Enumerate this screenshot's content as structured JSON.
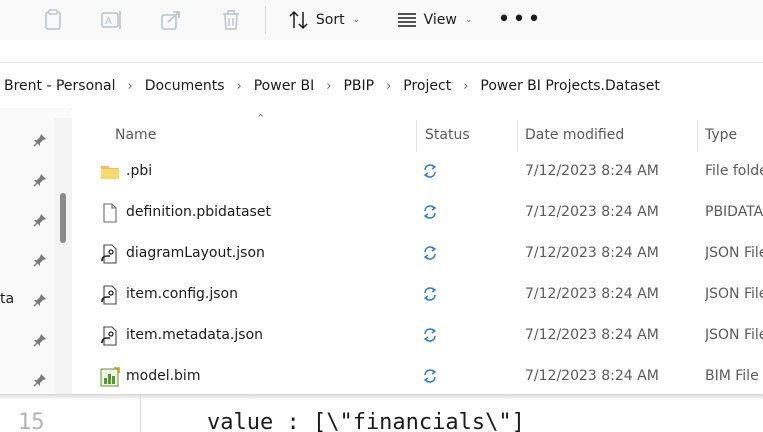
{
  "toolbar": {
    "sort_label": "Sort",
    "view_label": "View",
    "more_label": "•••",
    "icons": [
      "clipboard-icon",
      "rename-icon",
      "share-icon",
      "delete-icon",
      "sort-icon",
      "view-icon",
      "more-icon"
    ]
  },
  "address": {
    "crumbs": [
      "Brent - Personal",
      "Documents",
      "Power BI",
      "PBIP",
      "Project",
      "Power BI Projects.Dataset"
    ]
  },
  "nav": {
    "partial_label": "ta"
  },
  "columns": {
    "name": "Name",
    "status": "Status",
    "date_modified": "Date modified",
    "type": "Type"
  },
  "files": [
    {
      "name": ".pbi",
      "date": "7/12/2023 8:24 AM",
      "type": "File folde",
      "icon": "folder-icon"
    },
    {
      "name": "definition.pbidataset",
      "date": "7/12/2023 8:24 AM",
      "type": "PBIDATA",
      "icon": "file-icon"
    },
    {
      "name": "diagramLayout.json",
      "date": "7/12/2023 8:24 AM",
      "type": "JSON File",
      "icon": "json-file-icon"
    },
    {
      "name": "item.config.json",
      "date": "7/12/2023 8:24 AM",
      "type": "JSON File",
      "icon": "json-file-icon"
    },
    {
      "name": "item.metadata.json",
      "date": "7/12/2023 8:24 AM",
      "type": "JSON File",
      "icon": "json-file-icon"
    },
    {
      "name": "model.bim",
      "date": "7/12/2023 8:24 AM",
      "type": "BIM File",
      "icon": "bim-file-icon"
    }
  ],
  "code": {
    "line_number": "15",
    "text": "value : [\\\"financials\\\"]"
  },
  "colors": {
    "sync_icon": "#2b7cd3",
    "folder": "#f3c24b",
    "toolbar_bg": "#f9f9f9"
  }
}
